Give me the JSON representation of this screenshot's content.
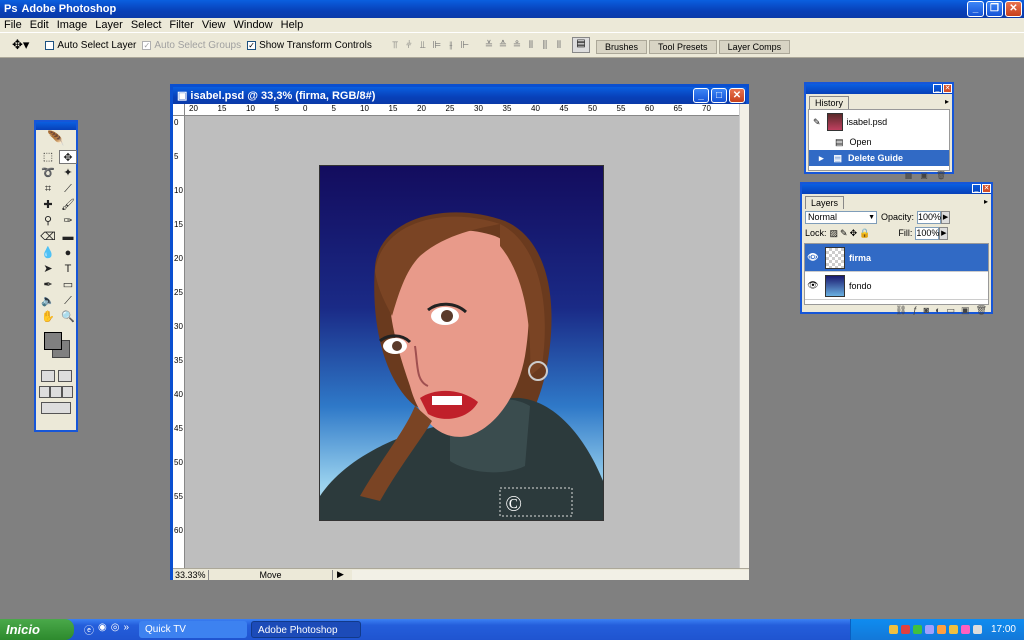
{
  "app": {
    "title": "Adobe Photoshop"
  },
  "menu": [
    "File",
    "Edit",
    "Image",
    "Layer",
    "Select",
    "Filter",
    "View",
    "Window",
    "Help"
  ],
  "options": {
    "auto_select_layer": "Auto Select Layer",
    "auto_select_groups": "Auto Select Groups",
    "show_transform_controls": "Show Transform Controls",
    "auto_select_layer_checked": false,
    "show_transform_checked": true
  },
  "palette_well": [
    "Brushes",
    "Tool Presets",
    "Layer Comps"
  ],
  "document": {
    "title": "isabel.psd @ 33,3% (firma, RGB/8#)",
    "zoom": "33.33%",
    "status_tool": "Move",
    "ruler_top": [
      "20",
      "15",
      "10",
      "5",
      "0",
      "5",
      "10",
      "15",
      "20",
      "25",
      "30",
      "35",
      "40",
      "45",
      "50",
      "55",
      "60",
      "65",
      "70"
    ],
    "ruler_left": [
      "0",
      "5",
      "10",
      "15",
      "20",
      "25",
      "30",
      "35",
      "40",
      "45",
      "50",
      "55",
      "60"
    ]
  },
  "history": {
    "tab": "History",
    "snapshot": "isabel.psd",
    "items": [
      {
        "label": "Open",
        "selected": false
      },
      {
        "label": "Delete Guide",
        "selected": true
      }
    ]
  },
  "layers": {
    "tab": "Layers",
    "blend_mode": "Normal",
    "opacity_label": "Opacity:",
    "opacity": "100%",
    "lock_label": "Lock:",
    "fill_label": "Fill:",
    "fill": "100%",
    "items": [
      {
        "name": "firma",
        "selected": true
      },
      {
        "name": "fondo",
        "selected": false
      }
    ]
  },
  "taskbar": {
    "start": "Inicio",
    "tasks": [
      "Quick TV",
      "Adobe Photoshop"
    ],
    "clock": "17:00"
  }
}
